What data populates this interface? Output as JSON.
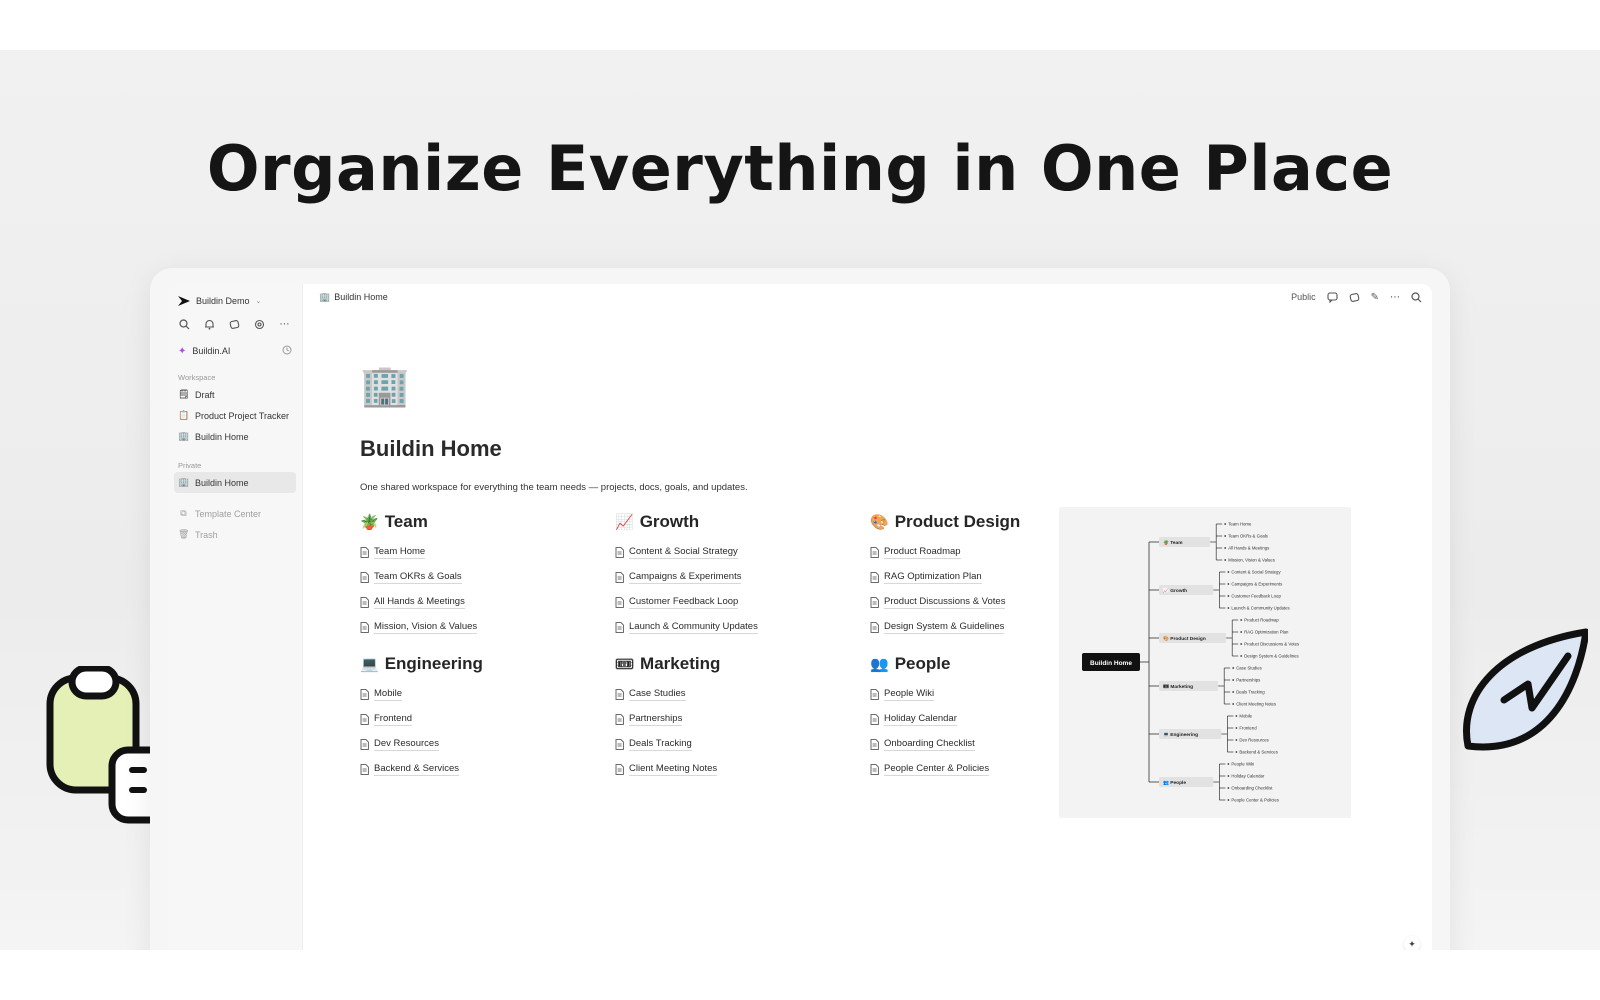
{
  "hero": {
    "headline": "Organize Everything in One Place"
  },
  "sidebar": {
    "workspace_name": "Buildin Demo",
    "ai_label": "Buildin.AI",
    "workspace_section": "Workspace",
    "workspace_items": [
      {
        "label": "Draft",
        "icon": "🗒"
      },
      {
        "label": "Product Project Tracker",
        "icon": "📋"
      },
      {
        "label": "Buildin Home",
        "icon": "🏢"
      }
    ],
    "private_section": "Private",
    "private_items": [
      {
        "label": "Buildin Home",
        "icon": "🏢"
      }
    ],
    "footer_items": [
      {
        "label": "Template Center",
        "icon": "template-icon"
      },
      {
        "label": "Trash",
        "icon": "trash-icon"
      }
    ]
  },
  "topbar": {
    "breadcrumb": "Buildin Home",
    "public_label": "Public"
  },
  "page": {
    "icon": "🏢",
    "title": "Buildin Home",
    "description": "One shared workspace for everything the team needs — projects, docs, goals, and updates."
  },
  "sections": [
    {
      "emoji": "🪴",
      "title": "Team",
      "items": [
        "Team Home",
        "Team OKRs & Goals",
        "All Hands & Meetings",
        "Mission, Vision & Values"
      ]
    },
    {
      "emoji": "📈",
      "title": "Growth",
      "items": [
        "Content & Social Strategy",
        "Campaigns & Experiments",
        "Customer Feedback Loop",
        "Launch & Community Updates"
      ]
    },
    {
      "emoji": "🎨",
      "title": "Product Design",
      "items": [
        "Product Roadmap",
        "RAG Optimization Plan",
        "Product Discussions & Votes",
        "Design System & Guidelines"
      ]
    },
    {
      "emoji": "💻",
      "title": "Engineering",
      "items": [
        "Mobile",
        "Frontend",
        "Dev Resources",
        "Backend & Services"
      ]
    },
    {
      "emoji": "🎟",
      "title": "Marketing",
      "items": [
        "Case Studies",
        "Partnerships",
        "Deals Tracking",
        "Client Meeting Notes"
      ]
    },
    {
      "emoji": "👥",
      "title": "People",
      "items": [
        "People Wiki",
        "Holiday Calendar",
        "Onboarding Checklist",
        "People Center & Policies"
      ]
    }
  ],
  "mindmap": {
    "root": "Buildin Home",
    "branches": [
      {
        "label": "🪴 Team",
        "children": [
          "Team Home",
          "Team OKRs & Goals",
          "All Hands & Meetings",
          "Mission, Vision & Values"
        ]
      },
      {
        "label": "📈 Growth",
        "children": [
          "Content & Social Strategy",
          "Campaigns & Experiments",
          "Customer Feedback Loop",
          "Launch & Community Updates"
        ]
      },
      {
        "label": "🎨 Product Design",
        "children": [
          "Product Roadmap",
          "RAG Optimization Plan",
          "Product Discussions & Votes",
          "Design System & Guidelines"
        ]
      },
      {
        "label": "🎟 Marketing",
        "children": [
          "Case Studies",
          "Partnerships",
          "Deals Tracking",
          "Client Meeting Notes"
        ]
      },
      {
        "label": "💻 Engineering",
        "children": [
          "Mobile",
          "Frontend",
          "Dev Resources",
          "Backend & Services"
        ]
      },
      {
        "label": "👥 People",
        "children": [
          "People Wiki",
          "Holiday Calendar",
          "Onboarding Checklist",
          "People Center & Policies"
        ]
      }
    ]
  },
  "colors": {
    "deco_green": "#e4f0b5",
    "deco_blue": "#dde6f5",
    "ai_purple": "#b04de0"
  }
}
